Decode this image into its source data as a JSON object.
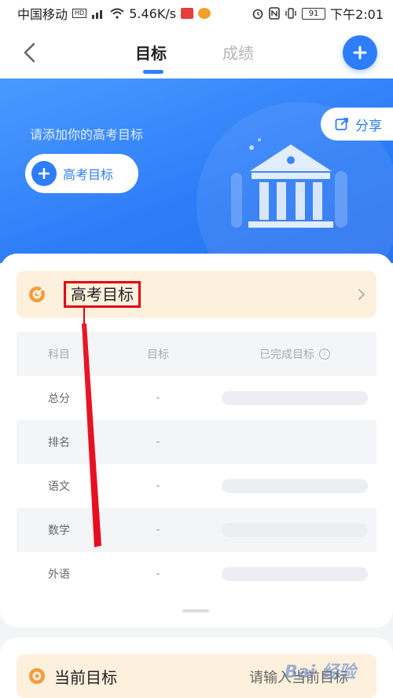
{
  "status_bar": {
    "carrier": "中国移动",
    "net_speed": "5.46K/s",
    "battery": "91",
    "time": "下午2:01"
  },
  "nav": {
    "tabs": [
      {
        "label": "目标",
        "active": true
      },
      {
        "label": "成绩",
        "active": false
      }
    ]
  },
  "banner": {
    "hint": "请添加你的高考目标",
    "add_button_label": "高考目标",
    "share_label": "分享"
  },
  "goal_section": {
    "title": "高考目标"
  },
  "table": {
    "headers": [
      "科目",
      "目标",
      "已完成目标"
    ],
    "rows": [
      {
        "subject": "总分",
        "target": "-"
      },
      {
        "subject": "排名",
        "target": "-"
      },
      {
        "subject": "语文",
        "target": "-"
      },
      {
        "subject": "数学",
        "target": "-"
      },
      {
        "subject": "外语",
        "target": "-"
      }
    ]
  },
  "current_section": {
    "title": "当前目标",
    "hint": "请输入当前目标"
  },
  "watermark": "Bai 经验",
  "colors": {
    "primary": "#2d7dfc",
    "goal_bg": "#fdf0dd",
    "goal_icon": "#f39c3c",
    "annotation": "#e50012"
  }
}
